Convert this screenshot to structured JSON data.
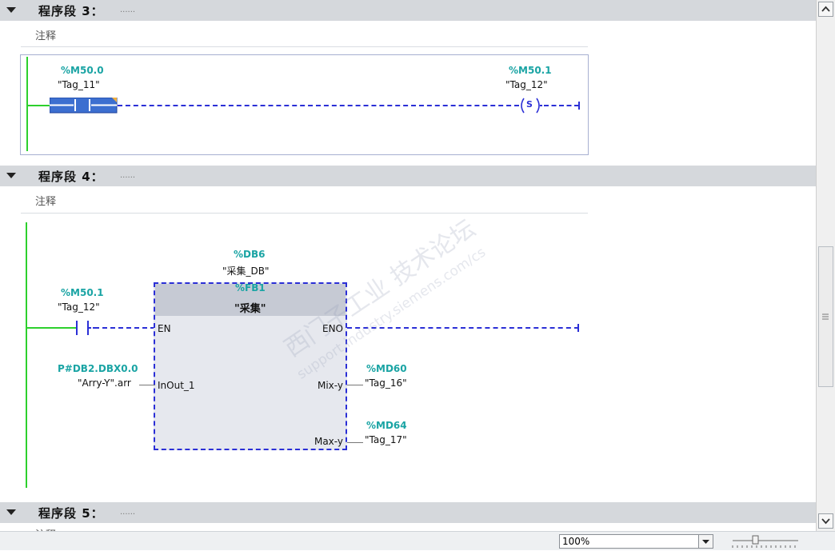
{
  "networks": [
    {
      "title": "程序段 3：",
      "dots": "......",
      "comment": "注释"
    },
    {
      "title": "程序段 4：",
      "dots": "......",
      "comment": "注释"
    },
    {
      "title": "程序段 5：",
      "dots": "......",
      "comment": "注释"
    }
  ],
  "net3": {
    "contact": {
      "address": "%M50.0",
      "tag": "\"Tag_11\""
    },
    "coil": {
      "address": "%M50.1",
      "tag": "\"Tag_12\"",
      "symbol": "S"
    }
  },
  "net4": {
    "contact": {
      "address": "%M50.1",
      "tag": "\"Tag_12\""
    },
    "instance_db": {
      "address": "%DB6",
      "name": "\"采集_DB\""
    },
    "fb": {
      "address": "%FB1",
      "name": "\"采集\""
    },
    "pins": {
      "en": "EN",
      "eno": "ENO",
      "inout1": "InOut_1",
      "mixy": "Mix-y",
      "maxy": "Max-y"
    },
    "inout1_param": {
      "address": "P#DB2.DBX0.0",
      "tag": "\"Arry-Y\".arr"
    },
    "mixy_param": {
      "address": "%MD60",
      "tag": "\"Tag_16\""
    },
    "maxy_param": {
      "address": "%MD64",
      "tag": "\"Tag_17\""
    }
  },
  "watermark": {
    "line1": "西门子工业 技术论坛",
    "line2": "support.industry.siemens.com/cs"
  },
  "statusbar": {
    "zoom_value": "100%"
  },
  "colors": {
    "address": "#1aa4a4",
    "power_rail": "#2dd02d",
    "dashed_wire": "#2b2fd6",
    "header_bg": "#d5d8dc"
  }
}
